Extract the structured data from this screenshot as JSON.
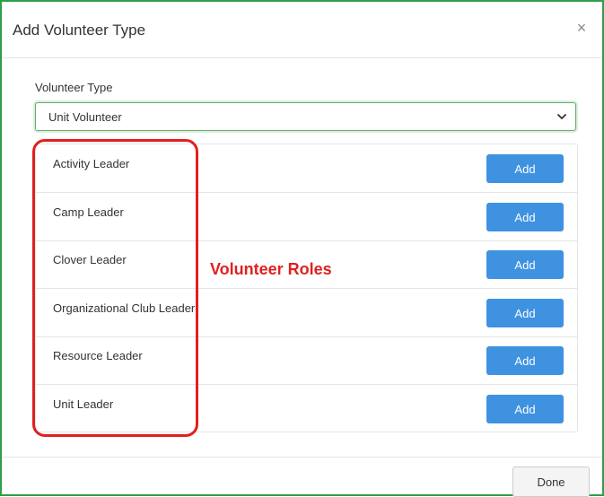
{
  "modal": {
    "title": "Add Volunteer Type",
    "close_label": "×"
  },
  "volunteer_type": {
    "label": "Volunteer Type",
    "selected": "Unit Volunteer"
  },
  "roles": [
    {
      "name": "Activity Leader",
      "action": "Add"
    },
    {
      "name": "Camp Leader",
      "action": "Add"
    },
    {
      "name": "Clover Leader",
      "action": "Add"
    },
    {
      "name": "Organizational Club Leader",
      "action": "Add"
    },
    {
      "name": "Resource Leader",
      "action": "Add"
    },
    {
      "name": "Unit Leader",
      "action": "Add"
    }
  ],
  "annotation": {
    "text": "Volunteer Roles",
    "color": "#e02020"
  },
  "footer": {
    "done_label": "Done"
  },
  "colors": {
    "frame_border": "#2e9e4a",
    "add_button": "#3f92e0",
    "highlight": "#e02020"
  }
}
